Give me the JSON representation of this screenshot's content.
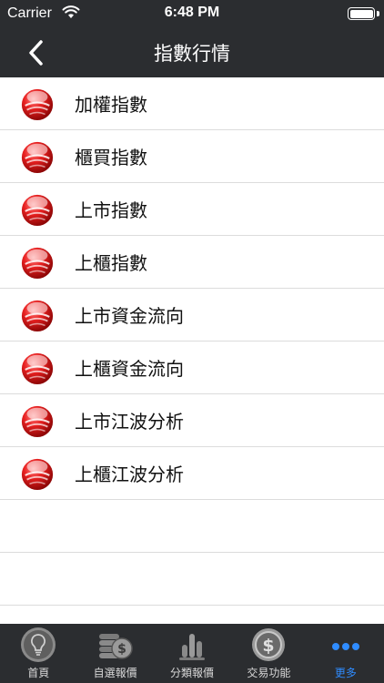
{
  "status": {
    "carrier": "Carrier",
    "time": "6:48 PM",
    "icons": [
      "wifi-icon",
      "battery-icon"
    ]
  },
  "nav": {
    "title": "指數行情",
    "back_icon": "chevron-left-icon"
  },
  "list": {
    "item_icon": "red-ball-icon",
    "items": [
      {
        "label": "加權指數"
      },
      {
        "label": "櫃買指數"
      },
      {
        "label": "上市指數"
      },
      {
        "label": "上櫃指數"
      },
      {
        "label": "上市資金流向"
      },
      {
        "label": "上櫃資金流向"
      },
      {
        "label": "上市江波分析"
      },
      {
        "label": "上櫃江波分析"
      }
    ]
  },
  "tabbar": {
    "active_color": "#2f8cff",
    "tabs": [
      {
        "label": "首頁",
        "icon": "lightbulb-icon"
      },
      {
        "label": "自選報價",
        "icon": "coin-stack-icon"
      },
      {
        "label": "分類報價",
        "icon": "bar-chart-icon"
      },
      {
        "label": "交易功能",
        "icon": "dollar-coin-icon"
      },
      {
        "label": "更多",
        "icon": "more-dots-icon",
        "active": true
      }
    ]
  },
  "colors": {
    "header_bg": "#2b2d30",
    "ball_red": "#e01818"
  }
}
